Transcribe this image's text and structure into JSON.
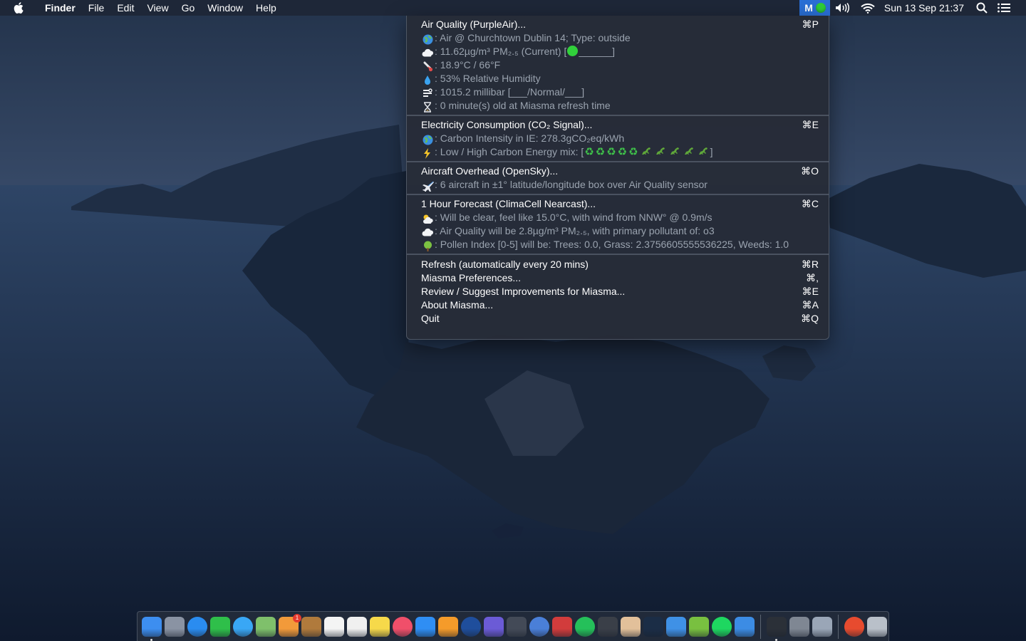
{
  "menubar": {
    "app_name": "Finder",
    "menus": [
      "File",
      "Edit",
      "View",
      "Go",
      "Window",
      "Help"
    ],
    "status_item_label": "M",
    "status_item_state_color": "#2fcf3a",
    "clock": "Sun 13 Sep  21:37",
    "icons": [
      "apple-logo-icon",
      "volume-icon",
      "wifi-icon",
      "spotlight-search-icon",
      "notification-center-icon"
    ]
  },
  "dropdown": {
    "air_quality": {
      "title": "Air Quality (PurpleAir)...",
      "shortcut": "⌘P",
      "lines": [
        {
          "icon": "globe-icon",
          "text": ": Air @ Churchtown Dublin 14; Type: outside"
        },
        {
          "icon": "cloud-icon",
          "text": ": 11.62µg/m³ PM₂.₅ (Current)   [",
          "gauge_level_fraction": 0.0,
          "gauge_suffix": "______]"
        },
        {
          "icon": "thermometer-icon",
          "text": ": 18.9°C / 66°F"
        },
        {
          "icon": "droplet-icon",
          "text": ": 53% Relative Humidity"
        },
        {
          "icon": "wind-icon",
          "text": ": 1015.2 millibar             [___/Normal/___]"
        },
        {
          "icon": "hourglass-icon",
          "text": ": 0 minute(s) old at Miasma refresh time"
        }
      ]
    },
    "electricity": {
      "title": "Electricity Consumption (CO₂ Signal)...",
      "shortcut": "⌘E",
      "lines": [
        {
          "icon": "globe-icon",
          "text": ": Carbon Intensity in IE: 278.3gCO₂eq/kWh"
        },
        {
          "icon": "lightning-icon",
          "text": ": Low / High Carbon Energy mix: [",
          "mix_low": 5,
          "mix_high": 5,
          "suffix": "]"
        }
      ]
    },
    "aircraft": {
      "title": "Aircraft Overhead (OpenSky)...",
      "shortcut": "⌘O",
      "lines": [
        {
          "icon": "airplane-icon",
          "text": ": 6 aircraft in ±1° latitude/longitude box over Air Quality sensor"
        }
      ]
    },
    "forecast": {
      "title": "1 Hour Forecast (ClimaCell Nearcast)...",
      "shortcut": "⌘C",
      "lines": [
        {
          "icon": "sun-cloud-icon",
          "text": ": Will be clear, feel like 15.0°C, with wind from NNW° @ 0.9m/s"
        },
        {
          "icon": "cloud-icon",
          "text": ": Air Quality will be 2.8µg/m³ PM₂.₅, with primary pollutant of: o3"
        },
        {
          "icon": "tree-icon",
          "text": ": Pollen Index [0-5] will be: Trees: 0.0, Grass: 2.3756605555536225, Weeds: 1.0"
        }
      ]
    },
    "actions": [
      {
        "label": "Refresh (automatically every 20 mins)",
        "shortcut": "⌘R"
      },
      {
        "label": "Miasma Preferences...",
        "shortcut": "⌘,"
      },
      {
        "label": "Review / Suggest Improvements for Miasma...",
        "shortcut": "⌘E"
      },
      {
        "label": "About Miasma...",
        "shortcut": "⌘A"
      },
      {
        "label": "Quit",
        "shortcut": "⌘Q"
      }
    ]
  },
  "dock": {
    "apps": [
      {
        "name": "finder-icon",
        "color": "#3d8ef0",
        "running": true
      },
      {
        "name": "launchpad-icon",
        "color": "#8a93a3"
      },
      {
        "name": "safari-icon",
        "color": "#2a8cf0"
      },
      {
        "name": "facetime-icon",
        "color": "#2fbf4a"
      },
      {
        "name": "messages-icon",
        "color": "#39a7f5"
      },
      {
        "name": "maps-icon",
        "color": "#7fc06b"
      },
      {
        "name": "photos-icon",
        "color": "#f29a3a",
        "badge": "1"
      },
      {
        "name": "notefile-icon",
        "color": "#b07a3c"
      },
      {
        "name": "calendar-icon",
        "color": "#f4f4f4"
      },
      {
        "name": "reminders-icon",
        "color": "#f0f0f0"
      },
      {
        "name": "notes-icon",
        "color": "#f6d94a"
      },
      {
        "name": "music-icon",
        "color": "#f04f6a"
      },
      {
        "name": "app-store-icon",
        "color": "#2f8ef4"
      },
      {
        "name": "home-icon",
        "color": "#f59b2a"
      },
      {
        "name": "quicktime-icon",
        "color": "#1f4e9c"
      },
      {
        "name": "imovie-icon",
        "color": "#6b5bd6"
      },
      {
        "name": "final-cut-icon",
        "color": "#434a57"
      },
      {
        "name": "system-preferences-gear-icon",
        "color": "#4a7fd8"
      },
      {
        "name": "photo-booth-icon",
        "color": "#d23c3c"
      },
      {
        "name": "whatsapp-icon",
        "color": "#25c05a"
      },
      {
        "name": "activity-viewer-icon",
        "color": "#3a3f48"
      },
      {
        "name": "pencil-icon",
        "color": "#e2c09a"
      },
      {
        "name": "steam-icon",
        "color": "#1b2d46"
      },
      {
        "name": "keynote-icon",
        "color": "#3f91e6"
      },
      {
        "name": "android-studio-icon",
        "color": "#79c040"
      },
      {
        "name": "spotify-icon",
        "color": "#1ed760"
      },
      {
        "name": "xcode-icon",
        "color": "#3c8ce4"
      },
      {
        "name": "separator"
      },
      {
        "name": "activity-monitor-icon",
        "color": "#2b3038",
        "running": true
      },
      {
        "name": "disk-utility-icon",
        "color": "#7f8793"
      },
      {
        "name": "preview-icon",
        "color": "#9aa6b7"
      },
      {
        "name": "separator"
      },
      {
        "name": "miasma-icon",
        "color": "#e74b2f"
      },
      {
        "name": "trash-icon",
        "color": "#b9c0c9"
      }
    ]
  }
}
